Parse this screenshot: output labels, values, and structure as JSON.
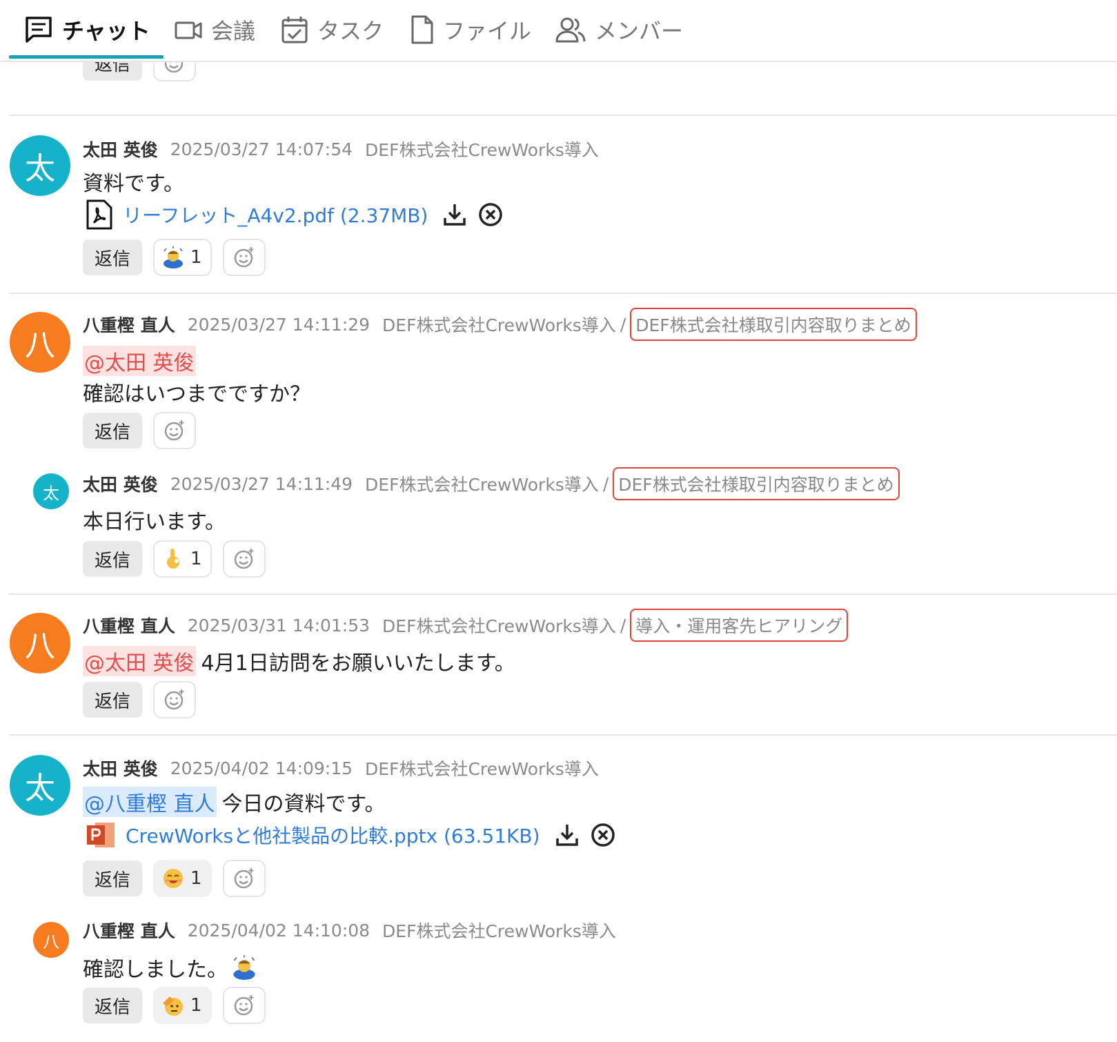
{
  "tabs": [
    {
      "label": "チャット",
      "icon": "chat-icon",
      "active": true
    },
    {
      "label": "会議",
      "icon": "video-icon"
    },
    {
      "label": "タスク",
      "icon": "task-icon"
    },
    {
      "label": "ファイル",
      "icon": "file-icon"
    },
    {
      "label": "メンバー",
      "icon": "members-icon"
    }
  ],
  "reply_label": "返信",
  "messages": [
    {
      "avatar_char": "太",
      "author": "太田 英俊",
      "timestamp": "2025/03/27 14:07:54",
      "channel": "DEF株式会社CrewWorks導入",
      "text": "資料です。",
      "file": {
        "name": "リーフレット_A4v2.pdf (2.37MB)",
        "type": "pdf-icon"
      },
      "reaction": {
        "emoji": "person-bowing-emoji",
        "count": "1"
      }
    },
    {
      "avatar_char": "八",
      "author": "八重樫 直人",
      "timestamp": "2025/03/27 14:11:29",
      "channel": "DEF株式会社CrewWorks導入",
      "slash": "/",
      "topic": "DEF株式会社様取引内容取りまとめ",
      "mention": "@太田 英俊",
      "text": "確認はいつまでですか？"
    },
    {
      "avatar_char": "太",
      "author": "太田 英俊",
      "timestamp": "2025/03/27 14:11:49",
      "channel": "DEF株式会社CrewWorks導入",
      "slash": "/",
      "topic": "DEF株式会社様取引内容取りまとめ",
      "text": "本日行います。",
      "reaction": {
        "emoji": "ok-hand-emoji",
        "count": "1"
      }
    },
    {
      "avatar_char": "八",
      "author": "八重樫 直人",
      "timestamp": "2025/03/31 14:01:53",
      "channel": "DEF株式会社CrewWorks導入",
      "slash": "/",
      "topic": "導入・運用客先ヒアリング",
      "mention": "@太田 英俊",
      "text": "4月1日訪問をお願いいたします。"
    },
    {
      "avatar_char": "太",
      "author": "太田 英俊",
      "timestamp": "2025/04/02 14:09:15",
      "channel": "DEF株式会社CrewWorks導入",
      "mention": "@八重樫 直人",
      "text": "今日の資料です。",
      "file": {
        "name": "CrewWorksと他社製品の比較.pptx (63.51KB)",
        "type": "pptx-icon"
      },
      "reaction": {
        "emoji": "smiling-face-emoji",
        "count": "1"
      }
    },
    {
      "avatar_char": "八",
      "author": "八重樫 直人",
      "timestamp": "2025/04/02 14:10:08",
      "channel": "DEF株式会社CrewWorks導入",
      "text": "確認しました。",
      "inline_emoji": "person-bowing-emoji",
      "reaction": {
        "emoji": "saluting-face-emoji",
        "count": "1"
      }
    }
  ],
  "colors": {
    "accent": "#16a0b9",
    "teal_avatar": "#16b2c9",
    "orange_avatar": "#f77b1f",
    "link": "#2f7dd8",
    "highlight_border": "#e0443a"
  }
}
